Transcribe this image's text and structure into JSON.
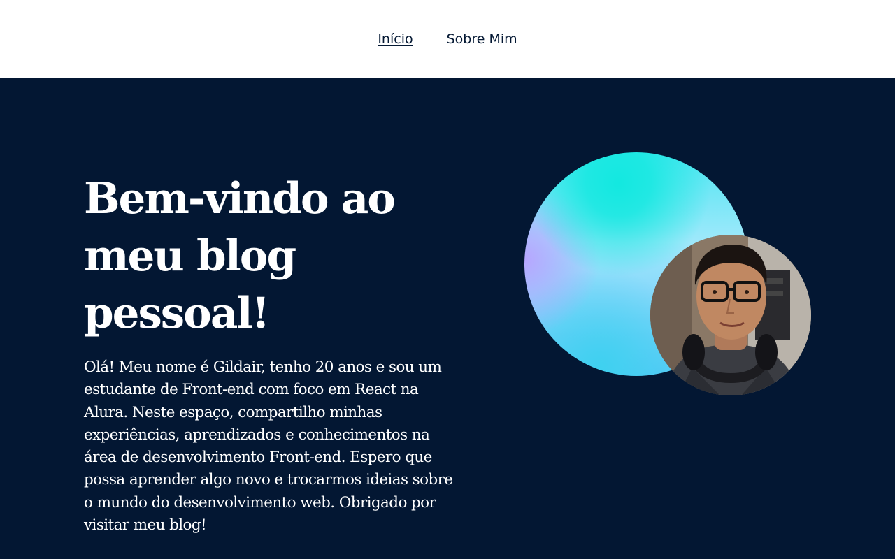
{
  "nav": {
    "links": [
      {
        "label": "Início",
        "active": true
      },
      {
        "label": "Sobre Mim",
        "active": false
      }
    ]
  },
  "hero": {
    "title": "Bem-vindo ao meu blog pessoal!",
    "description": "Olá! Meu nome é Gildair, tenho 20 anos e sou um estudante de Front-end com foco em React na Alura. Neste espaço, compartilho minhas experiências, aprendizados e conhecimentos na área de desenvolvimento Front-end. Espero que possa aprender algo novo e trocarmos ideias sobre o mundo do desenvolvimento web. Obrigado por visitar meu blog!"
  },
  "colors": {
    "navy": "#031733",
    "white": "#ffffff",
    "orb_cyan": "#13e8e0",
    "orb_violet": "#b7a6ff"
  }
}
